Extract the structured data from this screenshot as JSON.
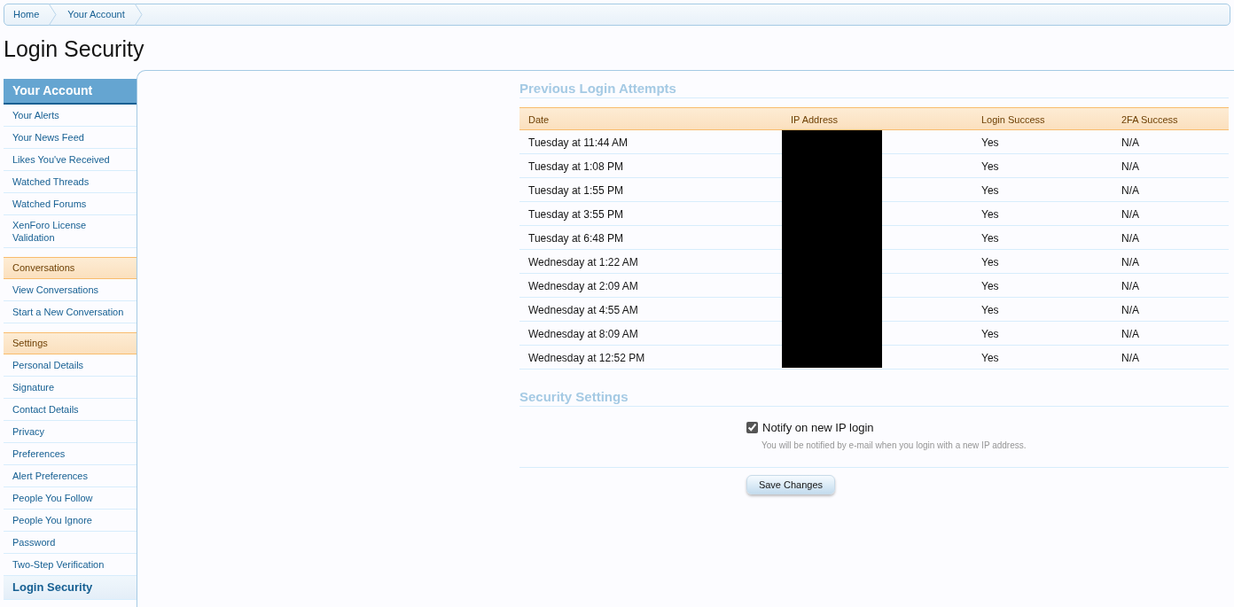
{
  "breadcrumb": [
    {
      "label": "Home"
    },
    {
      "label": "Your Account"
    }
  ],
  "title": "Login Security",
  "sidebar": {
    "sections": [
      {
        "title": "Your Account",
        "kind": "primary",
        "items": [
          {
            "label": "Your Alerts",
            "selected": false
          },
          {
            "label": "Your News Feed",
            "selected": false
          },
          {
            "label": "Likes You've Received",
            "selected": false
          },
          {
            "label": "Watched Threads",
            "selected": false
          },
          {
            "label": "Watched Forums",
            "selected": false
          },
          {
            "label": "XenForo License Validation",
            "selected": false
          }
        ]
      },
      {
        "title": "Conversations",
        "kind": "secondary",
        "items": [
          {
            "label": "View Conversations",
            "selected": false
          },
          {
            "label": "Start a New Conversation",
            "selected": false
          }
        ]
      },
      {
        "title": "Settings",
        "kind": "secondary",
        "items": [
          {
            "label": "Personal Details",
            "selected": false
          },
          {
            "label": "Signature",
            "selected": false
          },
          {
            "label": "Contact Details",
            "selected": false
          },
          {
            "label": "Privacy",
            "selected": false
          },
          {
            "label": "Preferences",
            "selected": false
          },
          {
            "label": "Alert Preferences",
            "selected": false
          },
          {
            "label": "People You Follow",
            "selected": false
          },
          {
            "label": "People You Ignore",
            "selected": false
          },
          {
            "label": "Password",
            "selected": false
          },
          {
            "label": "Two-Step Verification",
            "selected": false
          },
          {
            "label": "Login Security",
            "selected": true
          }
        ]
      }
    ]
  },
  "login_attempts": {
    "heading": "Previous Login Attempts",
    "ip_redacted": true,
    "columns": [
      "Date",
      "IP Address",
      "Login Success",
      "2FA Success"
    ],
    "rows": [
      {
        "date": "Tuesday at 11:44 AM",
        "login_success": "Yes",
        "twofa_success": "N/A"
      },
      {
        "date": "Tuesday at 1:08 PM",
        "login_success": "Yes",
        "twofa_success": "N/A"
      },
      {
        "date": "Tuesday at 1:55 PM",
        "login_success": "Yes",
        "twofa_success": "N/A"
      },
      {
        "date": "Tuesday at 3:55 PM",
        "login_success": "Yes",
        "twofa_success": "N/A"
      },
      {
        "date": "Tuesday at 6:48 PM",
        "login_success": "Yes",
        "twofa_success": "N/A"
      },
      {
        "date": "Wednesday at 1:22 AM",
        "login_success": "Yes",
        "twofa_success": "N/A"
      },
      {
        "date": "Wednesday at 2:09 AM",
        "login_success": "Yes",
        "twofa_success": "N/A"
      },
      {
        "date": "Wednesday at 4:55 AM",
        "login_success": "Yes",
        "twofa_success": "N/A"
      },
      {
        "date": "Wednesday at 8:09 AM",
        "login_success": "Yes",
        "twofa_success": "N/A"
      },
      {
        "date": "Wednesday at 12:52 PM",
        "login_success": "Yes",
        "twofa_success": "N/A"
      }
    ]
  },
  "security_settings": {
    "heading": "Security Settings",
    "option": {
      "label": "Notify on new IP login",
      "checked": true,
      "hint": "You will be notified by e-mail when you login with a new IP address."
    },
    "button": "Save Changes"
  }
}
